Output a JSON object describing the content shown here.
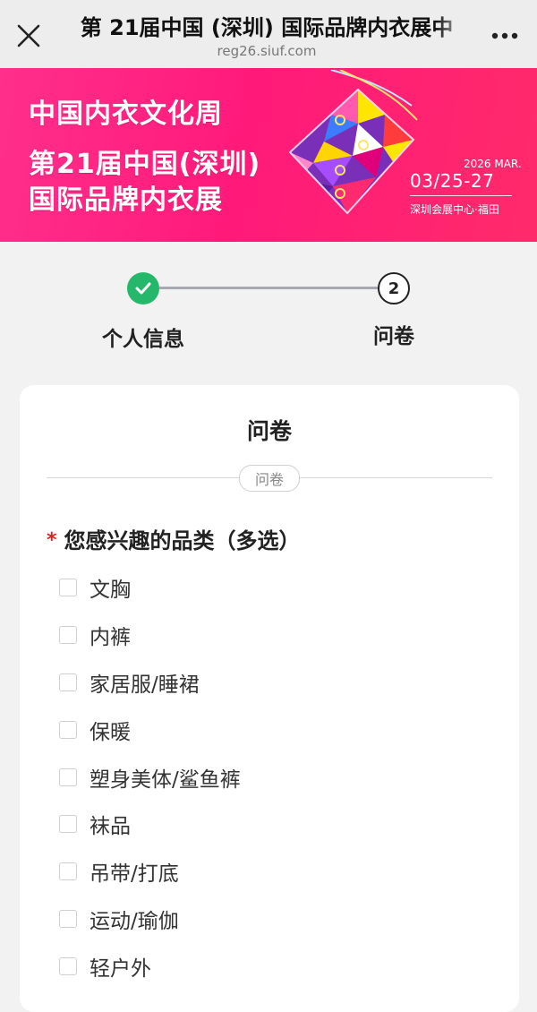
{
  "header": {
    "title": "第 21届中国 (深圳) 国际品牌内衣展中",
    "url": "reg26.siuf.com",
    "close_icon": "close-icon",
    "more_icon": "more-icon"
  },
  "banner": {
    "line1": "中国内衣文化周",
    "line2": "第21届中国(深圳)",
    "line3": "国际品牌内衣展",
    "year": "2026 MAR.",
    "dates": "03/25-27",
    "venue": "深圳会展中心·福田",
    "brand_color": "#ff1a7a"
  },
  "stepper": {
    "steps": [
      {
        "label": "个人信息",
        "status": "done",
        "icon": "check-icon"
      },
      {
        "number": "2",
        "label": "问卷",
        "status": "current"
      }
    ],
    "done_color": "#26b86a"
  },
  "card": {
    "title": "问卷",
    "section_tag": "问卷",
    "question": {
      "required_mark": "*",
      "text": "您感兴趣的品类（多选）",
      "options": [
        {
          "label": "文胸",
          "checked": false
        },
        {
          "label": "内裤",
          "checked": false
        },
        {
          "label": "家居服/睡裙",
          "checked": false
        },
        {
          "label": "保暖",
          "checked": false
        },
        {
          "label": "塑身美体/鲨鱼裤",
          "checked": false
        },
        {
          "label": "袜品",
          "checked": false
        },
        {
          "label": "吊带/打底",
          "checked": false
        },
        {
          "label": "运动/瑜伽",
          "checked": false
        },
        {
          "label": "轻户外",
          "checked": false
        }
      ]
    }
  }
}
